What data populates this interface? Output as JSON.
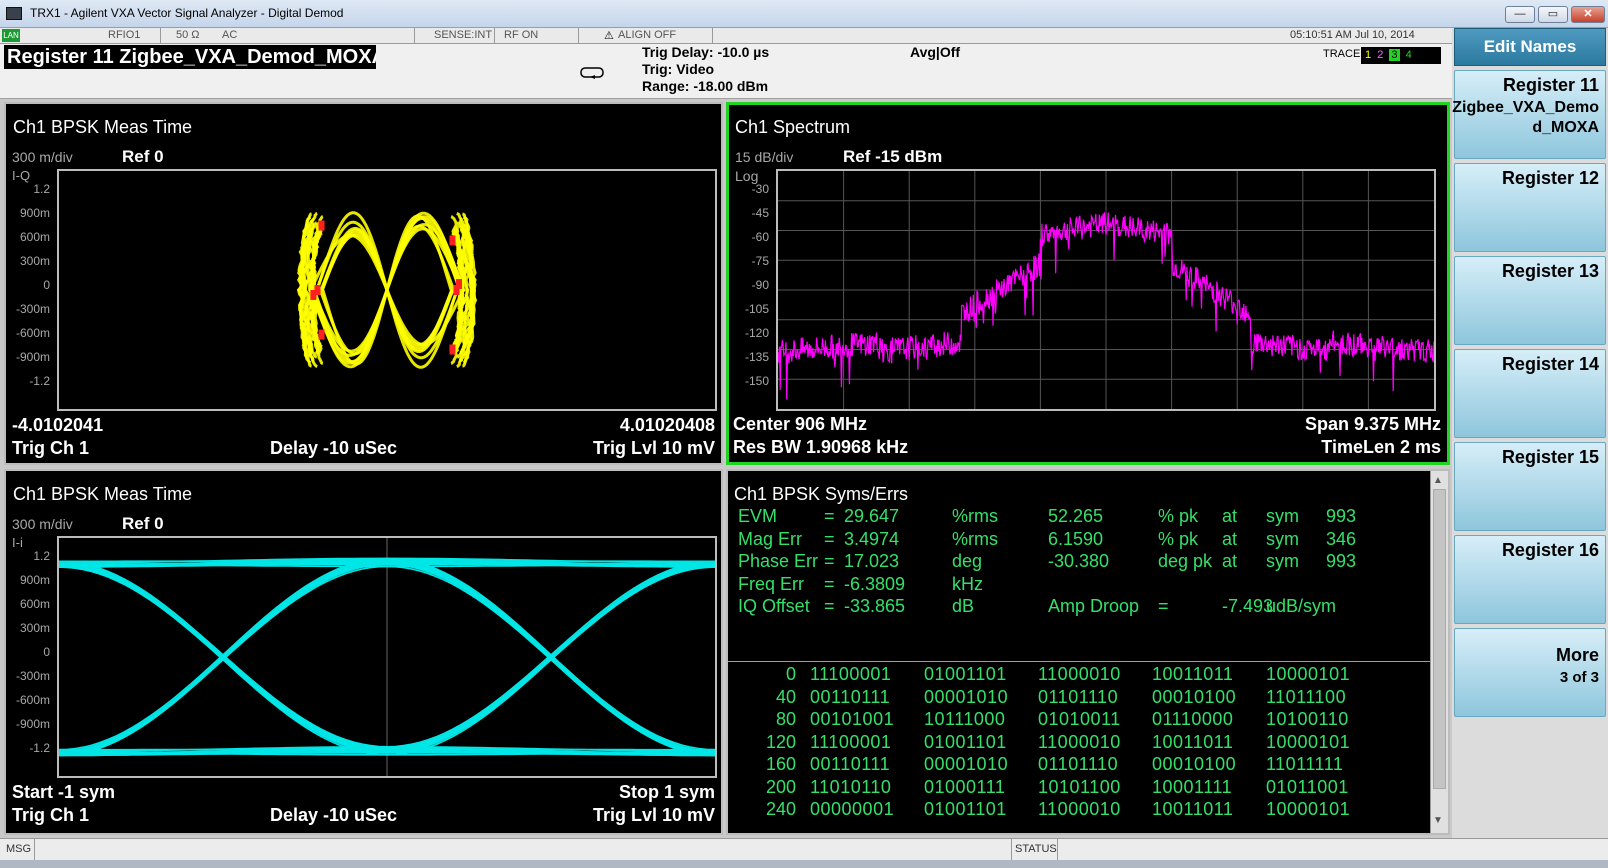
{
  "window": {
    "title": "TRX1 - Agilent VXA Vector Signal Analyzer - Digital Demod",
    "btn_min": "—",
    "btn_max": "▭",
    "btn_close": "✕"
  },
  "statusbar": {
    "lan": "LAN",
    "input": "RFIO1",
    "impedance": "50 Ω",
    "coupling": "AC",
    "sense": "SENSE:INT",
    "rf": "RF ON",
    "align": "ALIGN OFF",
    "datetime": "05:10:51 AM Jul 10, 2014"
  },
  "header": {
    "register_name": "Register 11 Zigbee_VXA_Demod_MOXA",
    "trig_delay": "Trig Delay: -10.0 µs",
    "trig": "Trig: Video",
    "range": "Range: -18.00 dBm",
    "avg": "Avg|Off",
    "trace_label": "TRACE",
    "traces": [
      "1",
      "2",
      "3",
      "4"
    ]
  },
  "panels": {
    "iq": {
      "title": "Ch1 BPSK Meas Time",
      "scale": "300 m/div",
      "ref": "Ref 0",
      "ylabel": "I-Q",
      "yticks": [
        "1.2",
        "900m",
        "600m",
        "300m",
        "0",
        "-300m",
        "-600m",
        "-900m",
        "-1.2"
      ],
      "x_left": "-4.0102041",
      "x_right": "4.01020408",
      "bl": "Trig Ch 1",
      "bc": "Delay -10 uSec",
      "br": "Trig Lvl 10 mV"
    },
    "spectrum": {
      "title": "Ch1 Spectrum",
      "scale": "15 dB/div",
      "ref": "Ref -15 dBm",
      "ylabel": "Log",
      "yticks": [
        "-30",
        "-45",
        "-60",
        "-75",
        "-90",
        "-105",
        "-120",
        "-135",
        "-150"
      ],
      "tl": "Center 906 MHz",
      "tr": "Span 9.375 MHz",
      "bl": "Res BW 1.90968 kHz",
      "br": "TimeLen 2 ms"
    },
    "eye": {
      "title": "Ch1 BPSK Meas Time",
      "scale": "300 m/div",
      "ref": "Ref 0",
      "ylabel": "I-i",
      "yticks": [
        "1.2",
        "900m",
        "600m",
        "300m",
        "0",
        "-300m",
        "-600m",
        "-900m",
        "-1.2"
      ],
      "tl": "Start -1  sym",
      "tr": "Stop 1  sym",
      "bl": "Trig Ch 1",
      "bc": "Delay -10 uSec",
      "br": "Trig Lvl 10 mV"
    },
    "syms": {
      "title": "Ch1 BPSK Syms/Errs",
      "rows": [
        {
          "name": "EVM",
          "eq": "=",
          "val": "29.647",
          "unit": "%rms",
          "pk": "52.265",
          "pkunit": "% pk",
          "at": "at",
          "sym": "sym",
          "symv": "993"
        },
        {
          "name": "Mag Err",
          "eq": "=",
          "val": "3.4974",
          "unit": "%rms",
          "pk": "6.1590",
          "pkunit": "% pk",
          "at": "at",
          "sym": "sym",
          "symv": "346"
        },
        {
          "name": "Phase Err",
          "eq": "=",
          "val": "17.023",
          "unit": "deg",
          "pk": "-30.380",
          "pkunit": "deg  pk",
          "at": "at",
          "sym": "sym",
          "symv": "993"
        },
        {
          "name": "Freq Err",
          "eq": "=",
          "val": "-6.3809",
          "unit": "kHz",
          "pk": "",
          "pkunit": "",
          "at": "",
          "sym": "",
          "symv": ""
        },
        {
          "name": "IQ Offset",
          "eq": "=",
          "val": "-33.865",
          "unit": "dB",
          "pk": "Amp Droop",
          "pkunit": "=",
          "at": "-7.493",
          "sym": "udB/sym",
          "symv": ""
        }
      ],
      "bits": [
        {
          "idx": "0",
          "b": [
            "11100001",
            "01001101",
            "11000010",
            "10011011",
            "10000101"
          ]
        },
        {
          "idx": "40",
          "b": [
            "00110111",
            "00001010",
            "01101110",
            "00010100",
            "11011100"
          ]
        },
        {
          "idx": "80",
          "b": [
            "00101001",
            "10111000",
            "01010011",
            "01110000",
            "10100110"
          ]
        },
        {
          "idx": "120",
          "b": [
            "11100001",
            "01001101",
            "11000010",
            "10011011",
            "10000101"
          ]
        },
        {
          "idx": "160",
          "b": [
            "00110111",
            "00001010",
            "01101110",
            "00010100",
            "11011111"
          ]
        },
        {
          "idx": "200",
          "b": [
            "11010110",
            "01000111",
            "10101100",
            "10001111",
            "01011001"
          ]
        },
        {
          "idx": "240",
          "b": [
            "00000001",
            "01001101",
            "11000010",
            "10011011",
            "10000101"
          ]
        }
      ]
    }
  },
  "softkeys": {
    "menu_title": "Edit Names",
    "keys": [
      {
        "l1": "Register 11",
        "l2": "Zigbee_VXA_Demo",
        "l3": "d_MOXA"
      },
      {
        "l1": "Register 12"
      },
      {
        "l1": "Register 13"
      },
      {
        "l1": "Register 14"
      },
      {
        "l1": "Register 15"
      },
      {
        "l1": "Register 16"
      },
      {
        "l1": "More",
        "l2": "3 of 3"
      }
    ]
  },
  "msgbar": {
    "msg": "MSG",
    "status": "STATUS"
  },
  "colors": {
    "iq_trace": "#ffff00",
    "iq_points": "#ff2020",
    "spectrum_trace": "#ff00ff",
    "eye_trace": "#00e5e5",
    "active_border": "#22d422",
    "text_green": "#35e06a"
  }
}
